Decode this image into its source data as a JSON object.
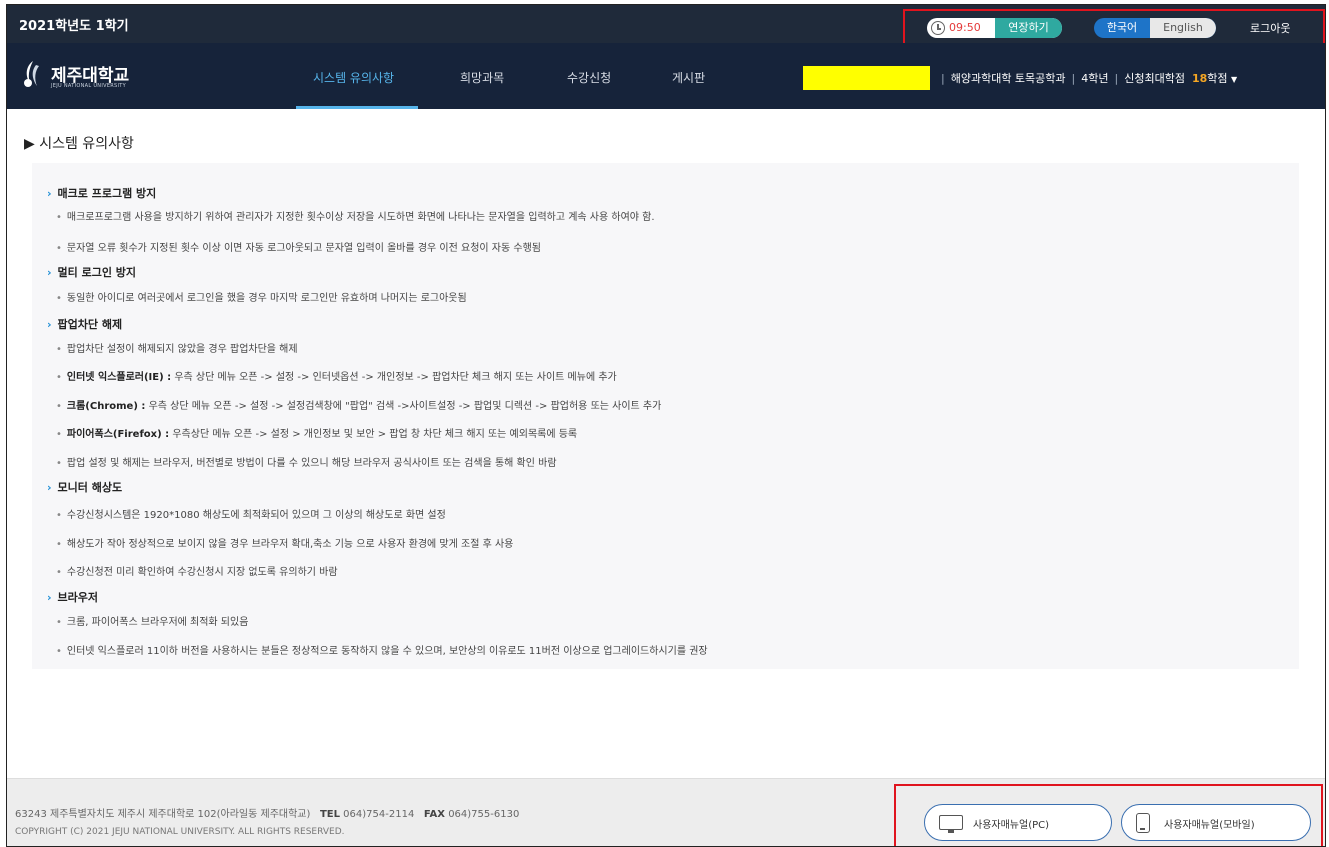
{
  "topbar": {
    "semester": "2021학년도 1학기",
    "timer": "09:50",
    "extend_label": "연장하기",
    "lang_ko": "한국어",
    "lang_en": "English",
    "logout": "로그아웃"
  },
  "nav": {
    "logo_name": "제주대학교",
    "logo_sub": "JEJU NATIONAL UNIVERSITY",
    "items": [
      {
        "label": "시스템 유의사항"
      },
      {
        "label": "희망과목"
      },
      {
        "label": "수강신청"
      },
      {
        "label": "게시판"
      }
    ],
    "department": "해양과학대학 토목공학과",
    "grade": "4학년",
    "max_credits_label": "신청최대학점",
    "max_credits": "18",
    "credits_unit": "학점"
  },
  "page": {
    "title": "시스템 유의사항"
  },
  "sections": [
    {
      "title": "매크로 프로그램 방지",
      "bullets": [
        {
          "bold": "",
          "text": "매크로프로그램 사용을 방지하기 위하여 관리자가 지정한 횟수이상 저장을 시도하면 화면에 나타나는 문자열을 입력하고 계속 사용 하여야 함."
        },
        {
          "bold": "",
          "text": "문자열 오류 횟수가 지정된 횟수 이상 이면 자동 로그아웃되고 문자열 입력이 올바를 경우 이전 요청이 자동 수행됨"
        }
      ]
    },
    {
      "title": "멀티 로그인 방지",
      "bullets": [
        {
          "bold": "",
          "text": "동일한 아이디로 여러곳에서 로그인을 했을 경우 마지막 로그인만 유효하며 나머지는 로그아웃됨"
        }
      ]
    },
    {
      "title": "팝업차단 해제",
      "bullets": [
        {
          "bold": "",
          "text": "팝업차단 설정이 해제되지 않았을 경우 팝업차단을 해제"
        },
        {
          "bold": "인터넷 익스플로러(IE) :",
          "text": " 우측 상단 메뉴 오픈 -> 설정 -> 인터넷옵션 -> 개인정보 -> 팝업차단 체크 해지 또는 사이트 메뉴에 추가"
        },
        {
          "bold": "크롬(Chrome) :",
          "text": " 우측 상단 메뉴 오픈 -> 설정 -> 설정검색창에 \"팝업\" 검색 ->사이트설정 -> 팝업및 디렉션 -> 팝업허용 또는 사이트 추가"
        },
        {
          "bold": "파이어폭스(Firefox) :",
          "text": " 우측상단 메뉴 오픈 -> 설정 > 개인정보 및 보안 > 팝업 창 차단 체크 해지 또는 예외목록에 등록"
        },
        {
          "bold": "",
          "text": "팝업 설정 및 해제는 브라우저, 버전별로 방법이 다를 수 있으니 해당 브라우저 공식사이트 또는 검색을 통해 확인 바람"
        }
      ]
    },
    {
      "title": "모니터 해상도",
      "bullets": [
        {
          "bold": "",
          "text": "수강신청시스템은 1920*1080 해상도에 최적화되어 있으며 그 이상의 해상도로 화면 설정"
        },
        {
          "bold": "",
          "text": "해상도가 작아 정상적으로 보이지 않을 경우 브라우저 확대,축소 기능 으로 사용자 환경에 맞게 조절 후 사용"
        },
        {
          "bold": "",
          "text": "수강신청전 미리 확인하여 수강신청시 지장 없도록 유의하기 바람"
        }
      ]
    },
    {
      "title": "브라우저",
      "bullets": [
        {
          "bold": "",
          "text": "크롬, 파이어폭스 브라우저에 최적화 되있음"
        },
        {
          "bold": "",
          "text": "인터넷 익스플로러 11이하 버전을 사용하시는 분들은 정상적으로 동작하지 않을 수 있으며, 보안상의 이유로도 11버전 이상으로 업그레이드하시기를 권장"
        }
      ]
    }
  ],
  "footer": {
    "address": "63243 제주특별자치도 제주시 제주대학로 102(아라일동 제주대학교)",
    "tel_label": "TEL",
    "tel": "064)754-2114",
    "fax_label": "FAX",
    "fax": "064)755-6130",
    "copyright": "COPYRIGHT (C) 2021 JEJU NATIONAL UNIVERSITY. ALL RIGHTS RESERVED.",
    "manual_pc": "사용자매뉴얼(PC)",
    "manual_mobile": "사용자매뉴얼(모바일)"
  }
}
